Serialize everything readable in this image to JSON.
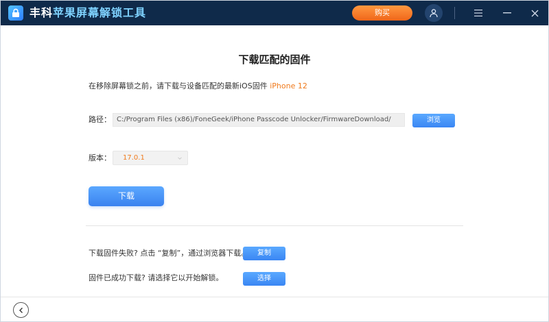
{
  "titlebar": {
    "title_part1": "丰科",
    "title_part2": "苹果屏幕解锁工具",
    "buy_label": "购买",
    "icons": [
      "lock-logo-icon",
      "user-icon",
      "menu-icon",
      "minimize-icon",
      "close-icon"
    ]
  },
  "main": {
    "page_title": "下载匹配的固件",
    "instruction_prefix": "在移除屏幕锁之前，请下载与设备匹配的最新iOS固件",
    "device_name": "iPhone 12",
    "path_label": "路径：",
    "path_value": "C:/Program Files (x86)/FoneGeek/iPhone Passcode Unlocker/FirmwareDownload/",
    "browse_label": "浏览",
    "version_label": "版本：",
    "version_value": "17.0.1",
    "download_label": "下载",
    "fail_text": "下载固件失败? 点击 “复制”，通过浏览器下载。",
    "copy_label": "复制",
    "success_text": "固件已成功下载? 请选择它以开始解锁。",
    "select_label": "选择"
  },
  "footer": {
    "back_icon": "chevron-left-icon"
  },
  "colors": {
    "titlebar_bg": "#0f2a4a",
    "accent_blue": "#3a86f3",
    "accent_orange": "#f07a1c",
    "buy_orange": "#f57a22"
  }
}
